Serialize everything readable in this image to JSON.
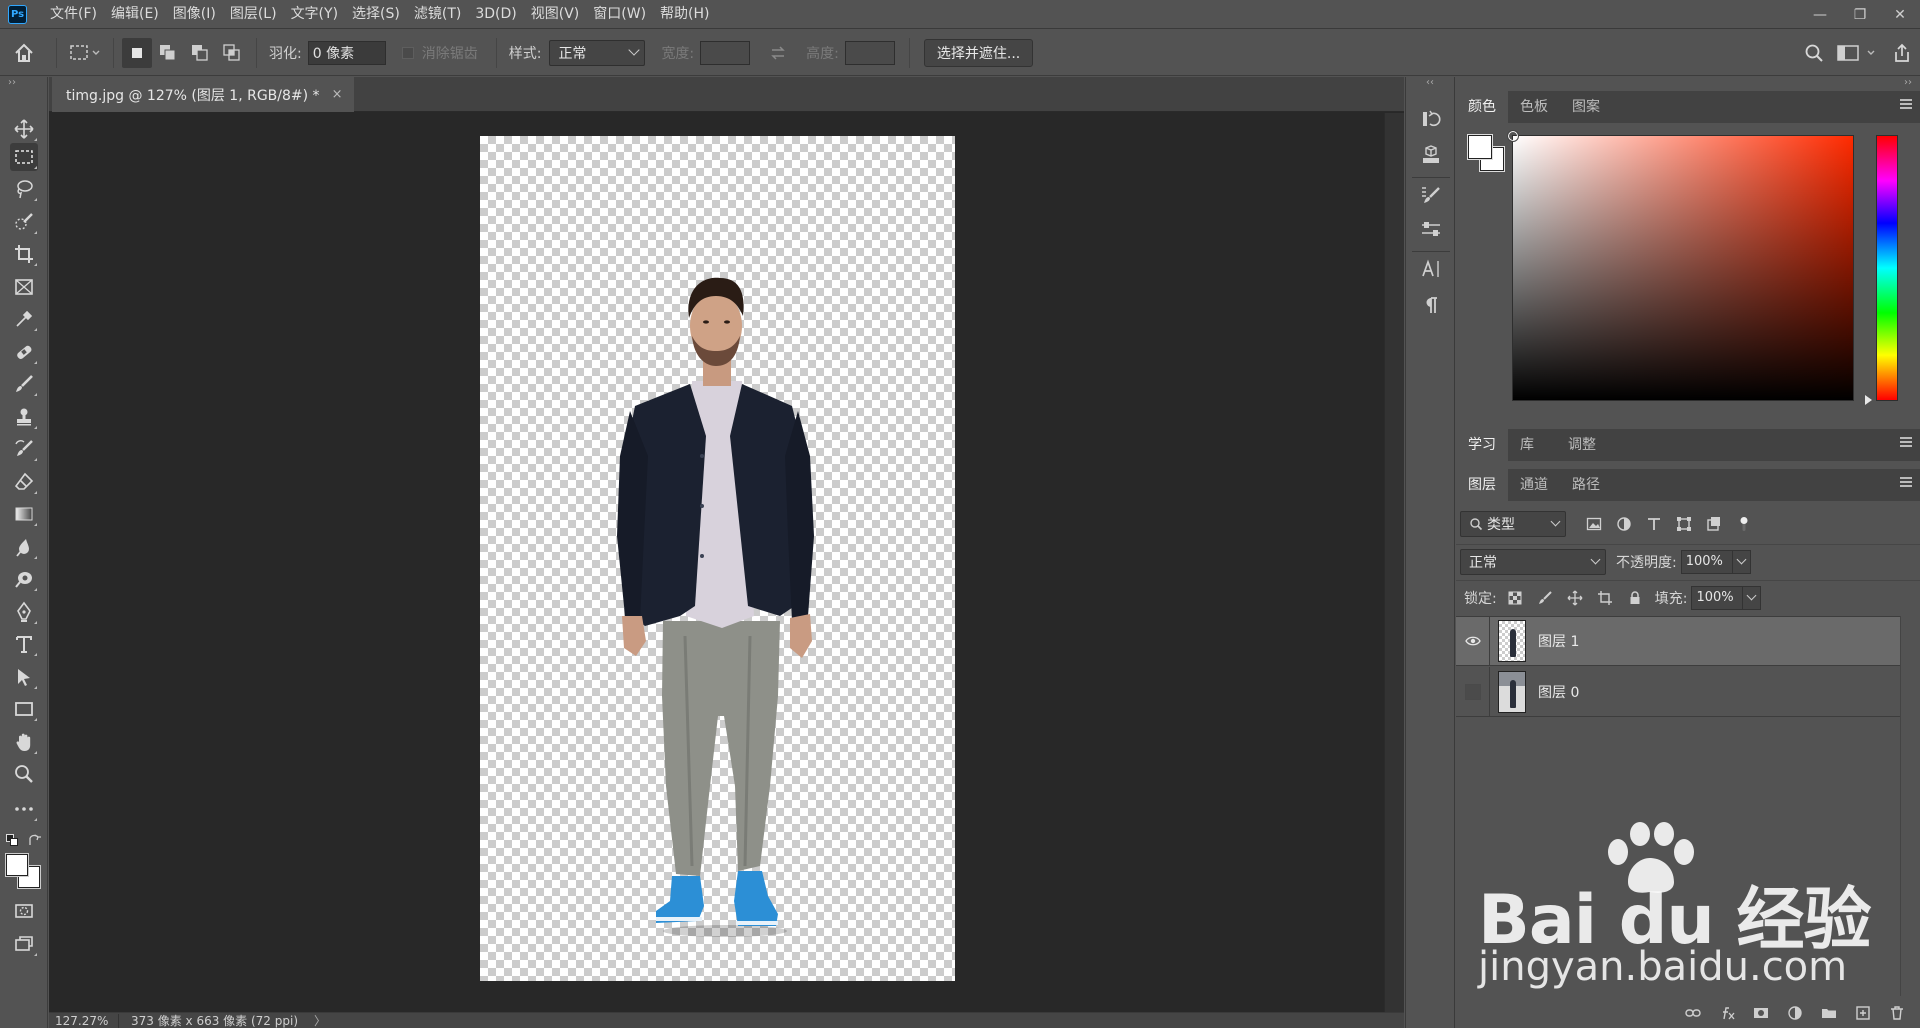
{
  "app": {
    "logo_text": "Ps"
  },
  "menu": {
    "items": [
      "文件(F)",
      "编辑(E)",
      "图像(I)",
      "图层(L)",
      "文字(Y)",
      "选择(S)",
      "滤镜(T)",
      "3D(D)",
      "视图(V)",
      "窗口(W)",
      "帮助(H)"
    ]
  },
  "window_controls": {
    "minimize": "—",
    "restore": "❐",
    "close": "✕"
  },
  "options_bar": {
    "feather_label": "羽化:",
    "feather_value": "0 像素",
    "antialias_label": "消除锯齿",
    "style_label": "样式:",
    "style_value": "正常",
    "width_label": "宽度:",
    "height_label": "高度:",
    "select_and_mask_label": "选择并遮住..."
  },
  "document": {
    "tab_title": "timg.jpg @ 127% (图层 1, RGB/8#) *",
    "tab_close": "×"
  },
  "status_bar": {
    "zoom": "127.27%",
    "doc_info": "373 像素 x 663 像素 (72 ppi)",
    "arrow": "〉"
  },
  "color_panel": {
    "tabs": [
      "颜色",
      "色板",
      "图案"
    ],
    "active_tab": 0,
    "foreground": "#ffffff",
    "background": "#ffffff"
  },
  "learn_panel": {
    "tabs": [
      "学习",
      "库",
      "调整"
    ],
    "active_tab": 0
  },
  "layers_panel": {
    "tabs": [
      "图层",
      "通道",
      "路径"
    ],
    "active_tab": 0,
    "filter_value": "类型",
    "blend_mode": "正常",
    "opacity_label": "不透明度:",
    "opacity_value": "100%",
    "lock_label": "锁定:",
    "fill_label": "填充:",
    "fill_value": "100%",
    "layers": [
      {
        "name": "图层 1",
        "visible": true,
        "selected": true
      },
      {
        "name": "图层 0",
        "visible": false,
        "selected": false
      }
    ]
  },
  "watermark": {
    "main": "Bai du 经验",
    "url": "jingyan.baidu.com"
  }
}
